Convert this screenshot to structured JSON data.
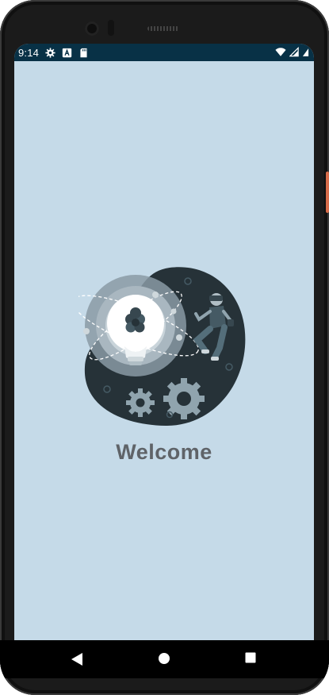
{
  "status_bar": {
    "time": "9:14",
    "left_icons": [
      "gear-icon",
      "font-a-icon",
      "sd-card-icon"
    ],
    "right_icons": [
      "wifi-icon",
      "cell-signal-icon",
      "battery-icon"
    ],
    "background_color": "#083146"
  },
  "screen": {
    "background_color": "#c5dae8",
    "illustration": "idea-lightbulb-gears-vr-illustration",
    "welcome_text": "Welcome"
  },
  "nav_bar": {
    "buttons": [
      "back-icon",
      "home-icon",
      "recents-icon"
    ]
  }
}
